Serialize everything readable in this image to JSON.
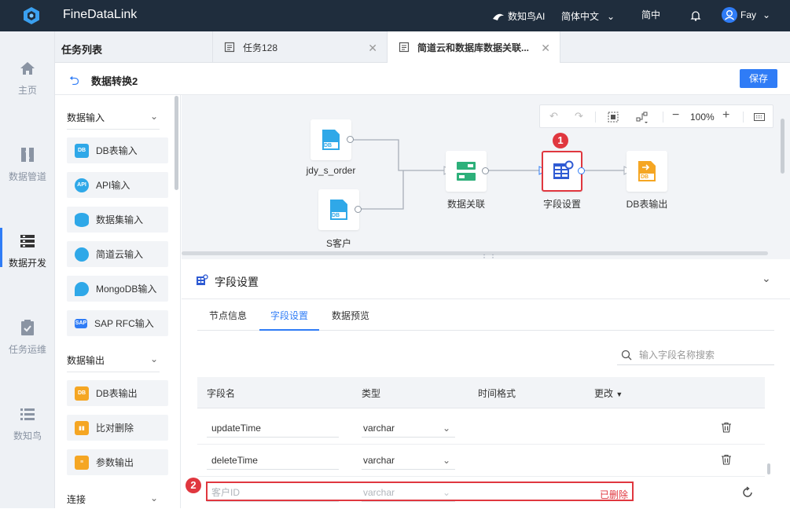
{
  "topbar": {
    "brand": "FineDataLink",
    "ai_label": "数知鸟AI",
    "language": "简体中文",
    "font_mode": "简中",
    "user": "Fay"
  },
  "leftnav": [
    {
      "label": "主页",
      "icon": "home-icon"
    },
    {
      "label": "数据管道",
      "icon": "pipeline-icon"
    },
    {
      "label": "数据开发",
      "icon": "dev-icon"
    },
    {
      "label": "任务运维",
      "icon": "clipboard-icon"
    },
    {
      "label": "数知鸟",
      "icon": "list-icon"
    }
  ],
  "tabs": {
    "task_list": "任务列表",
    "items": [
      {
        "label": "任务128"
      },
      {
        "label": "简道云和数据库数据关联..."
      }
    ]
  },
  "title_row": {
    "title": "数据转换2",
    "save": "保存"
  },
  "components": {
    "input_group": "数据输入",
    "inputs": [
      {
        "label": "DB表输入",
        "icon": "db-table-icon"
      },
      {
        "label": "API输入",
        "icon": "api-icon"
      },
      {
        "label": "数据集输入",
        "icon": "dataset-icon"
      },
      {
        "label": "简道云输入",
        "icon": "jiandaoyun-icon"
      },
      {
        "label": "MongoDB输入",
        "icon": "mongodb-icon"
      },
      {
        "label": "SAP RFC输入",
        "icon": "sap-icon"
      }
    ],
    "output_group": "数据输出",
    "outputs": [
      {
        "label": "DB表输出",
        "icon": "db-output-icon"
      },
      {
        "label": "比对删除",
        "icon": "compare-delete-icon"
      },
      {
        "label": "参数输出",
        "icon": "param-output-icon"
      }
    ],
    "connect_group": "连接"
  },
  "canvas": {
    "zoom": "100%",
    "nodes": [
      {
        "label": "jdy_s_order",
        "badge": "DB"
      },
      {
        "label": "S客户",
        "badge": "DB"
      },
      {
        "label": "数据关联"
      },
      {
        "label": "字段设置"
      },
      {
        "label": "DB表输出",
        "badge": "DB"
      }
    ]
  },
  "annotations": [
    "1",
    "2"
  ],
  "settings": {
    "title": "字段设置",
    "tabs": [
      "节点信息",
      "字段设置",
      "数据预览"
    ],
    "active_tab": "字段设置",
    "search_placeholder": "输入字段名称搜索",
    "columns": [
      "字段名",
      "类型",
      "时间格式",
      "更改"
    ],
    "rows": [
      {
        "name": "updateTime",
        "type": "varchar",
        "status": ""
      },
      {
        "name": "deleteTime",
        "type": "varchar",
        "status": ""
      },
      {
        "name": "客户ID",
        "type": "varchar",
        "status": "已删除"
      }
    ]
  },
  "colors": {
    "accent": "#2f7cf6",
    "topbar": "#1f2d3d",
    "danger": "#e0373f"
  }
}
